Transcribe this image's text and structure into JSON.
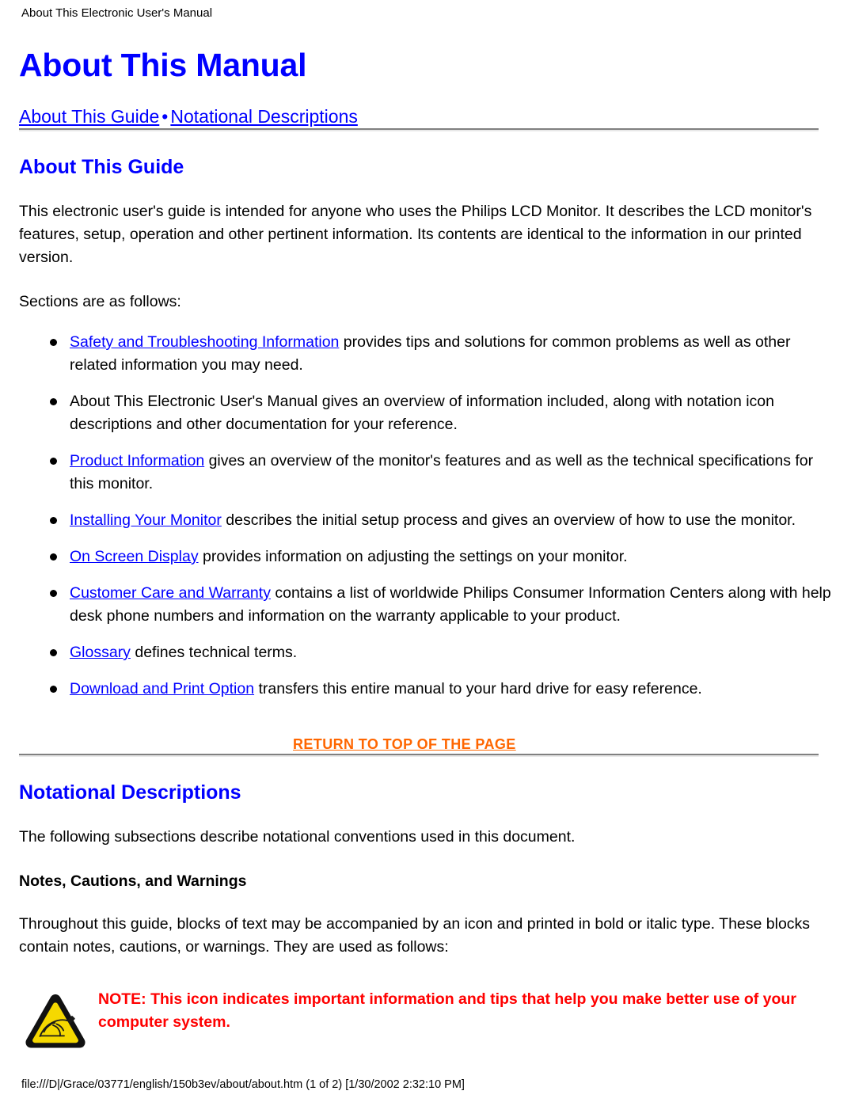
{
  "header": {
    "running_head": "About This Electronic User's Manual"
  },
  "title": "About This Manual",
  "subnav": {
    "link1": "About This Guide",
    "separator": "•",
    "link2": "Notational Descriptions"
  },
  "section_guide": {
    "heading": "About This Guide",
    "intro": "This electronic user's guide is intended for anyone who uses the Philips LCD Monitor. It describes the LCD monitor's features, setup, operation and other pertinent information. Its contents are identical to the information in our printed version.",
    "lead_in": "Sections are as follows:",
    "bullets": [
      {
        "link": "Safety and Troubleshooting Information",
        "rest": " provides tips and solutions for common problems as well as other related information you may need."
      },
      {
        "link": "",
        "rest": "About This Electronic User's Manual gives an overview of information included, along with notation icon descriptions and other documentation for your reference."
      },
      {
        "link": "Product Information",
        "rest": " gives an overview of the monitor's features and as well as the technical specifications for this monitor."
      },
      {
        "link": "Installing Your Monitor",
        "rest": " describes the initial setup process and gives an overview of how to use the monitor."
      },
      {
        "link": "On Screen Display",
        "rest": " provides information on adjusting the settings on your monitor."
      },
      {
        "link": "Customer Care and Warranty",
        "rest": " contains a list of worldwide Philips Consumer Information Centers along with help desk phone numbers and information on the warranty applicable to your product."
      },
      {
        "link": "Glossary",
        "rest": " defines technical terms."
      },
      {
        "link": "Download and Print Option",
        "rest": " transfers this entire manual to your hard drive for easy reference."
      }
    ],
    "return_to_top": "RETURN TO TOP OF THE PAGE"
  },
  "section_notation": {
    "heading": "Notational Descriptions",
    "intro": "The following subsections describe notational conventions used in this document.",
    "sub_head": "Notes, Cautions, and Warnings",
    "body": "Throughout this guide, blocks of text may be accompanied by an icon and printed in bold or italic type. These blocks contain notes, cautions, or warnings. They are used as follows:",
    "note": {
      "icon": "warning-triangle-note-icon",
      "text": "NOTE: This icon indicates important information and tips that help you make better use of your computer system."
    }
  },
  "footer": {
    "path_line": "file:///D|/Grace/03771/english/150b3ev/about/about.htm (1 of 2) [1/30/2002 2:32:10 PM]"
  },
  "colors": {
    "heading_blue": "#0000ff",
    "link_blue": "#0000ff",
    "return_orange": "#ff6600",
    "note_red": "#ff0000",
    "icon_yellow": "#f5d800",
    "text_black": "#000000"
  }
}
